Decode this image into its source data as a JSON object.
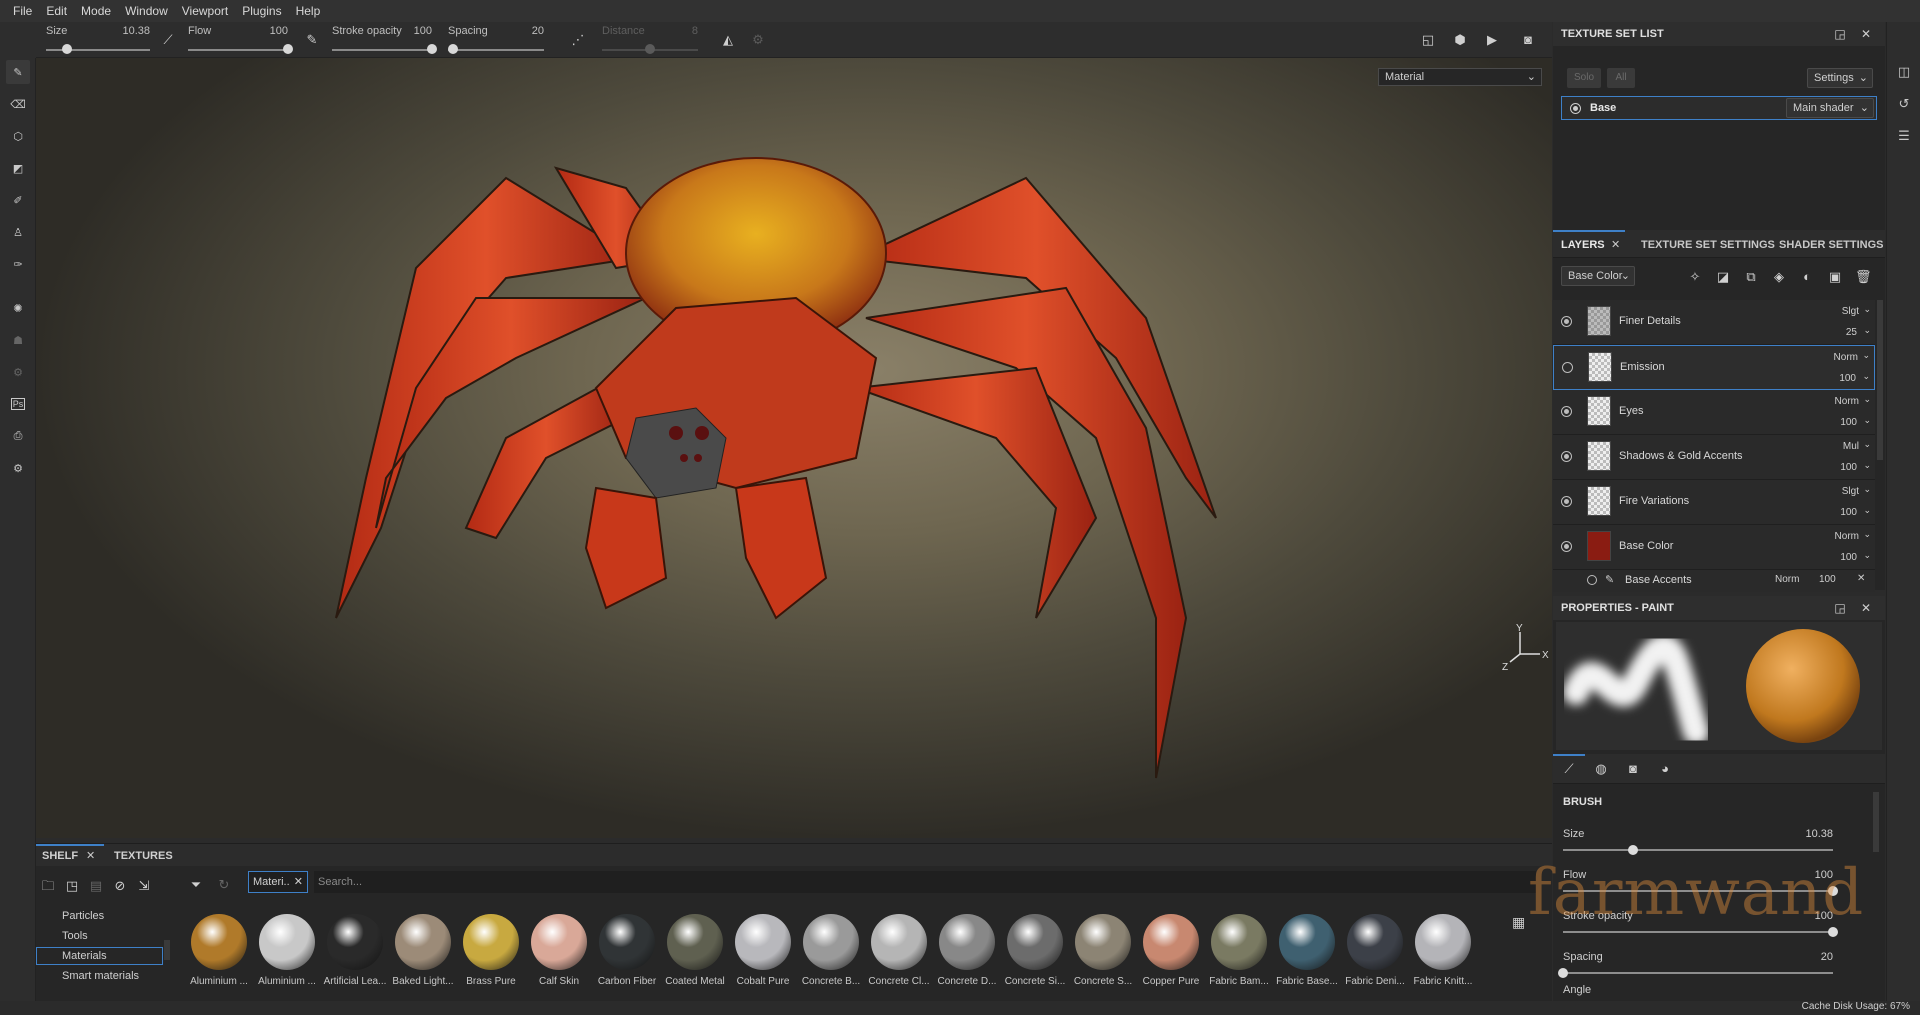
{
  "menu": [
    "File",
    "Edit",
    "Mode",
    "Window",
    "Viewport",
    "Plugins",
    "Help"
  ],
  "tool_options": {
    "size": {
      "label": "Size",
      "value": "10.38",
      "level": 0.2
    },
    "flow": {
      "label": "Flow",
      "value": "100",
      "level": 1.0
    },
    "stroke_opacity": {
      "label": "Stroke opacity",
      "value": "100",
      "level": 1.0
    },
    "spacing": {
      "label": "Spacing",
      "value": "20",
      "level": 0.05
    },
    "distance": {
      "label": "Distance",
      "value": "8",
      "level": 0.5
    }
  },
  "viewport": {
    "channel_select": "Material",
    "axis": {
      "y": "Y",
      "z": "Z",
      "x": "X"
    }
  },
  "texture_set_list": {
    "title": "TEXTURE SET LIST",
    "solo": "Solo",
    "all": "All",
    "settings": "Settings",
    "set_name": "Base",
    "shader": "Main shader"
  },
  "layers_panel": {
    "tabs": [
      "LAYERS",
      "TEXTURE SET SETTINGS",
      "SHADER SETTINGS"
    ],
    "channel": "Base Color",
    "layers": [
      {
        "name": "Finer Details",
        "blend": "Slgt",
        "opacity": "25",
        "visible": true,
        "thumb": "detail"
      },
      {
        "name": "Emission",
        "blend": "Norm",
        "opacity": "100",
        "visible": false,
        "thumb": "checker",
        "selected": true
      },
      {
        "name": "Eyes",
        "blend": "Norm",
        "opacity": "100",
        "visible": true,
        "thumb": "checker"
      },
      {
        "name": "Shadows & Gold Accents",
        "blend": "Mul",
        "opacity": "100",
        "visible": true,
        "thumb": "checker"
      },
      {
        "name": "Fire Variations",
        "blend": "Slgt",
        "opacity": "100",
        "visible": true,
        "thumb": "checker"
      },
      {
        "name": "Base Color",
        "blend": "Norm",
        "opacity": "100",
        "visible": true,
        "thumb": "red"
      }
    ],
    "sublayer": {
      "name": "Base Accents",
      "blend": "Norm",
      "opacity": "100"
    }
  },
  "properties": {
    "title": "PROPERTIES - PAINT",
    "section": "BRUSH",
    "sliders": [
      {
        "label": "Size",
        "value": "10.38",
        "level": 0.26
      },
      {
        "label": "Flow",
        "value": "100",
        "level": 1.0
      },
      {
        "label": "Stroke opacity",
        "value": "100",
        "level": 1.0
      },
      {
        "label": "Spacing",
        "value": "20",
        "level": 0.0
      }
    ],
    "cut_label": "Angle"
  },
  "shelf": {
    "tabs": [
      "SHELF",
      "TEXTURES"
    ],
    "categories": [
      "Particles",
      "Tools",
      "Materials",
      "Smart materials"
    ],
    "selected_category": "Materials",
    "filter_chip": "Materi..",
    "search_placeholder": "Search...",
    "materials": [
      {
        "name": "Aluminium ...",
        "color": "#b07a2a"
      },
      {
        "name": "Aluminium ...",
        "color": "#c8c8c8"
      },
      {
        "name": "Artificial Lea...",
        "color": "#2a2a2a"
      },
      {
        "name": "Baked Light...",
        "color": "#9c8b78"
      },
      {
        "name": "Brass Pure",
        "color": "#c8a940"
      },
      {
        "name": "Calf Skin",
        "color": "#d9a898"
      },
      {
        "name": "Carbon Fiber",
        "color": "#303436"
      },
      {
        "name": "Coated Metal",
        "color": "#5f6050"
      },
      {
        "name": "Cobalt Pure",
        "color": "#b8b8bc"
      },
      {
        "name": "Concrete B...",
        "color": "#9a9a9a"
      },
      {
        "name": "Concrete Cl...",
        "color": "#b5b5b5"
      },
      {
        "name": "Concrete D...",
        "color": "#888888"
      },
      {
        "name": "Concrete Si...",
        "color": "#6c6c6c"
      },
      {
        "name": "Concrete S...",
        "color": "#8c8474"
      },
      {
        "name": "Copper Pure",
        "color": "#c88870"
      },
      {
        "name": "Fabric Bam...",
        "color": "#7a7a62"
      },
      {
        "name": "Fabric Base...",
        "color": "#3f6070"
      },
      {
        "name": "Fabric Deni...",
        "color": "#3c4048"
      },
      {
        "name": "Fabric Knitt...",
        "color": "#b4b4b8"
      }
    ]
  },
  "status": {
    "cache": "Cache Disk Usage:",
    "cache_value": "67%"
  },
  "watermark": "farmwand",
  "colors": {
    "accent": "#3e80c8",
    "panel": "#262626"
  }
}
